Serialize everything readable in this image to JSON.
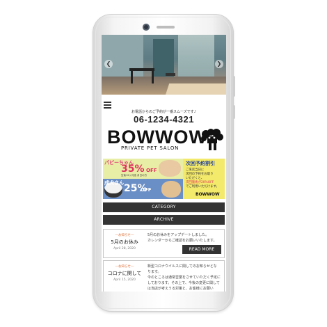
{
  "site": {
    "tel_note": "お電話からのご予約が一番スムーズです♪",
    "tel": "06-1234-4321",
    "logo": "BOWWOW",
    "logo_sub": "PRIVATE PET SALON"
  },
  "banner": {
    "puppy_title": "パピーちゃん",
    "puppy_pct": "35%",
    "puppy_off": "OFF",
    "puppy_note": "生後12ヶ月迄 月日の方",
    "adult_title": "成犬さん",
    "adult_pct": "25%",
    "adult_off": "OFF",
    "right_title": "次回予約割引",
    "right_lines": [
      "ご来店当日に",
      "次回の予約をお取り",
      "いただくと、",
      "次回施術が20%OFF",
      "でご利用いただけます。"
    ],
    "right_logo": "BOWWOW"
  },
  "nav": {
    "category": "CATEGORY",
    "archive": "ARCHIVE"
  },
  "posts": [
    {
      "category": "—お知らせ—",
      "title": "5月のお休み",
      "date": "April 28, 2020",
      "body": [
        "5月のお休みをアップデートしました。",
        "カレンダーからご確認をお願いいたします。"
      ],
      "button": "READ MORE"
    },
    {
      "category": "—お知らせ—",
      "title": "コロナに関して",
      "date": "April 15, 2020",
      "body": [
        "新型コロナウイルスに関してのお知らせとな",
        "ります。",
        "今のところは通常営業をさせていただく予定に",
        "しております。その上で、今後の変更に関して",
        "は当店が考えうる対策と、お客様にお願い"
      ]
    }
  ]
}
